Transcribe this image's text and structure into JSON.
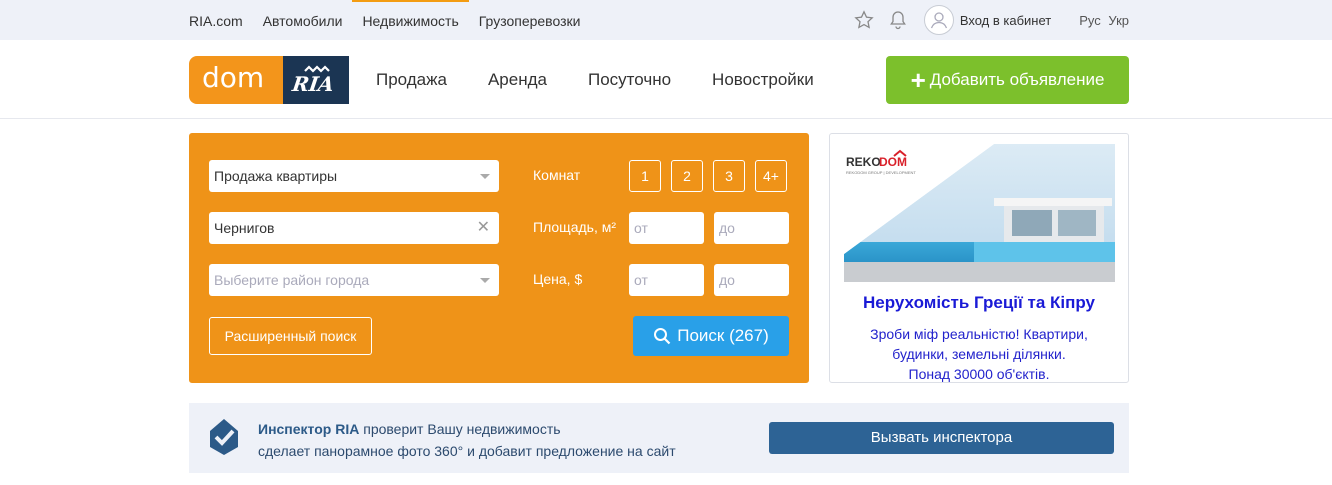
{
  "topbar": {
    "links": [
      "RIA.com",
      "Автомобили",
      "Недвижимость",
      "Грузоперевозки"
    ],
    "active_index": 2,
    "login_label": "Вход в кабинет",
    "lang_ru": "Рус",
    "lang_uk": "Укр"
  },
  "header": {
    "logo_dom": "dom",
    "logo_ria": "RIA",
    "nav": [
      "Продажа",
      "Аренда",
      "Посуточно",
      "Новостройки"
    ],
    "add_button": "Добавить объявление",
    "add_color": "#7cc02c"
  },
  "search": {
    "type_value": "Продажа квартиры",
    "city_value": "Чернигов",
    "district_placeholder": "Выберите район города",
    "rooms_label": "Комнат",
    "rooms": [
      "1",
      "2",
      "3",
      "4+"
    ],
    "area_label": "Площадь, м²",
    "price_label": "Цена, $",
    "from_placeholder": "от",
    "to_placeholder": "до",
    "advanced_button": "Расширенный поиск",
    "search_button": "Поиск (267)",
    "panel_color": "#ef9318"
  },
  "ad": {
    "brand": "REKODOM",
    "brand_sub": "REKODOM GROUP | DEVELOPMENT",
    "title": "Нерухомість Греції та Кіпру",
    "text_line1": "Зроби міф реальністю! Квартири,",
    "text_line2": "будинки, земельні ділянки.",
    "text_line3": "Понад 30000 об'єктів."
  },
  "inspector": {
    "brand": "Инспектор RIA",
    "line1_rest": " проверит Вашу недвижимость",
    "line2": "сделает панорамное фото 360° и добавит предложение на сайт",
    "button": "Вызвать инспектора"
  }
}
